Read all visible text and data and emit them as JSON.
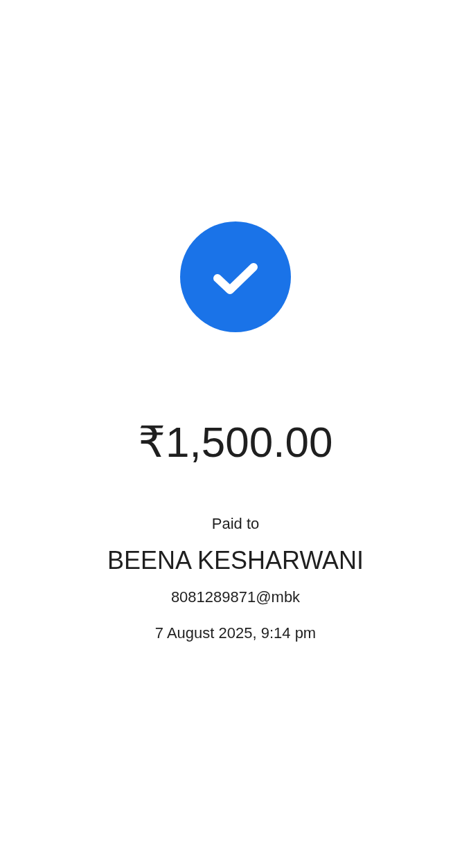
{
  "payment": {
    "amount": "₹1,500.00",
    "paid_to_label": "Paid to",
    "payee_name": "BEENA KESHARWANI",
    "upi_id": "8081289871@mbk",
    "datetime": "7 August 2025, 9:14 pm"
  }
}
